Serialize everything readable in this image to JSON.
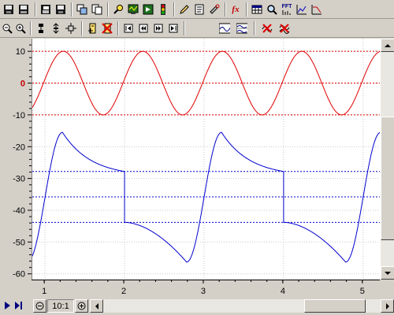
{
  "toolbar": {
    "row1_icons": [
      "save-icon",
      "save-all-icon",
      "copy-icon",
      "save-image-icon",
      "copy-window-icon",
      "paste-icon",
      "probe-icon",
      "monitor-icon",
      "export-icon",
      "traffic-light-icon",
      "edit-icon",
      "notes-icon",
      "tools-icon",
      "function-icon",
      "table-icon",
      "magnifier-icon",
      "fft-icon",
      "spectrum-icon",
      "bode-icon"
    ],
    "fx_label": "fx",
    "fft_label": "FFT"
  },
  "yaxis": {
    "ticks": [
      "10",
      "0",
      "-10",
      "-20",
      "-30",
      "-40",
      "-50",
      "-60"
    ],
    "zero_color": "#c00000"
  },
  "xaxis": {
    "ticks": [
      "1",
      "2",
      "3",
      "4",
      "5"
    ]
  },
  "bottom": {
    "zoom_label": "10:1"
  },
  "colors": {
    "red_trace": "#e00000",
    "blue_trace": "#0000d0",
    "red_grid": "#e00000",
    "blue_grid": "#0000d0",
    "plot_bg": "#ffffff"
  },
  "chart_data": {
    "type": "line",
    "xlim": [
      0.84,
      5.22
    ],
    "ylim": [
      -61.8,
      14.0
    ],
    "reference_lines": [
      10,
      0,
      -10,
      -27.8,
      -35.8,
      -43.8
    ],
    "series": [
      {
        "shape": "sine",
        "center": 0,
        "amplitude": 10,
        "period": 1.0,
        "peak_x": 1.23
      },
      {
        "shape": "square-response",
        "period": 2.0,
        "jump_x": [
          2.0,
          4.0
        ],
        "peak": -15.5,
        "trough": -56.3,
        "levels": [
          -27.8,
          -43.8
        ]
      }
    ]
  }
}
